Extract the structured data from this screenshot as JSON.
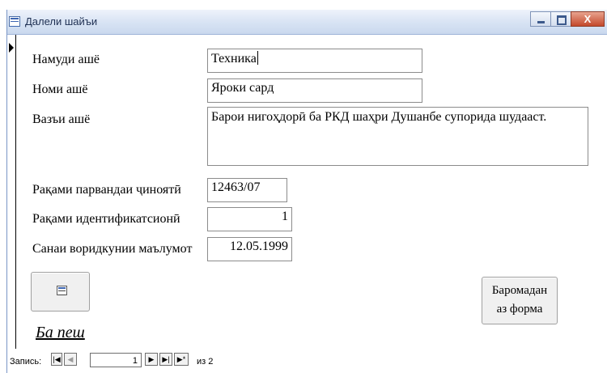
{
  "window": {
    "title": "Далели шайъи"
  },
  "form": {
    "fields": [
      {
        "label": "Намуди ашё",
        "value": "Техника"
      },
      {
        "label": "Номи ашё",
        "value": "Яроки сард"
      },
      {
        "label": "Вазъи ашё",
        "value": "Барои нигоҳдорӣ ба РКД шаҳри Душанбе супорида шудааст."
      },
      {
        "label": "Рақами парвандаи ҷиноятӣ",
        "value": "12463/07"
      },
      {
        "label": "Рақами идентификатсионӣ",
        "value": "1"
      },
      {
        "label": "Санаи воридкунии маълумот",
        "value": "12.05.1999"
      }
    ],
    "icon_button": {
      "icon": "form-icon"
    },
    "exit_button": {
      "line1": "Баромадан",
      "line2": "аз форма"
    },
    "back_link": "Ба пеш"
  },
  "navigation": {
    "label": "Запись:",
    "first": "|◀",
    "prev": "◀",
    "current": "1",
    "next": "▶",
    "last": "▶|",
    "new": "▶*",
    "total_text": "из 2"
  }
}
